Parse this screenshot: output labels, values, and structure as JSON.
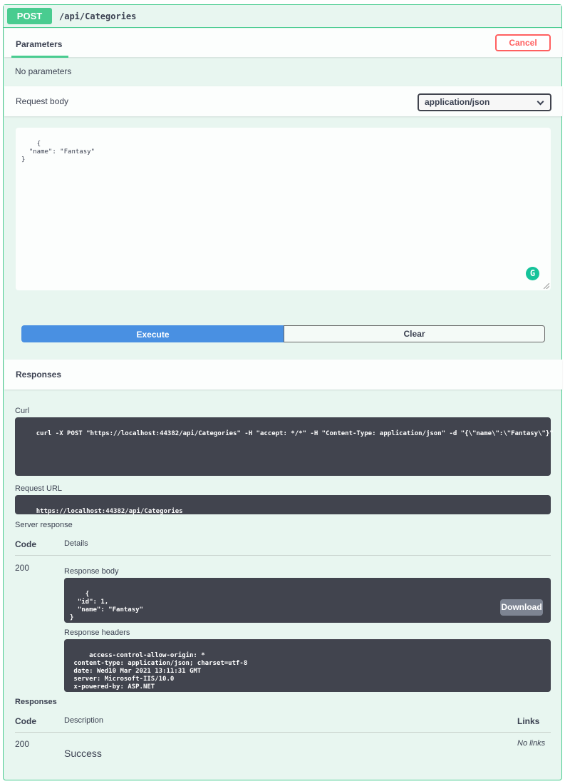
{
  "summary": {
    "method": "POST",
    "path": "/api/Categories"
  },
  "parameters": {
    "tab_label": "Parameters",
    "cancel_label": "Cancel",
    "empty_text": "No parameters"
  },
  "request_body": {
    "label": "Request body",
    "content_type": "application/json",
    "value": "{\n  \"name\": \"Fantasy\"\n}"
  },
  "actions": {
    "execute_label": "Execute",
    "clear_label": "Clear"
  },
  "responses_section": {
    "title": "Responses",
    "curl_label": "Curl",
    "curl_value": "curl -X POST \"https://localhost:44382/api/Categories\" -H \"accept: */*\" -H \"Content-Type: application/json\" -d \"{\\\"name\\\":\\\"Fantasy\\\"}\"",
    "request_url_label": "Request URL",
    "request_url_value": "https://localhost:44382/api/Categories",
    "server_response_label": "Server response",
    "code_header": "Code",
    "details_header": "Details",
    "status_code": "200",
    "response_body_label": "Response body",
    "response_body_value": "{\n  \"id\": 1,\n  \"name\": \"Fantasy\"\n}",
    "download_label": "Download",
    "response_headers_label": "Response headers",
    "response_headers_value": " access-control-allow-origin: *\n content-type: application/json; charset=utf-8\n date: Wed10 Mar 2021 13:11:31 GMT\n server: Microsoft-IIS/10.0\n x-powered-by: ASP.NET"
  },
  "documented_responses": {
    "title": "Responses",
    "code_header": "Code",
    "description_header": "Description",
    "links_header": "Links",
    "rows": [
      {
        "code": "200",
        "description": "Success",
        "links": "No links"
      }
    ]
  },
  "colors": {
    "post_green": "#49cc90",
    "block_background": "#e8f6f0",
    "execute_blue": "#4990e2",
    "cancel_red": "#ff6060",
    "dark_panel": "#41444e"
  }
}
